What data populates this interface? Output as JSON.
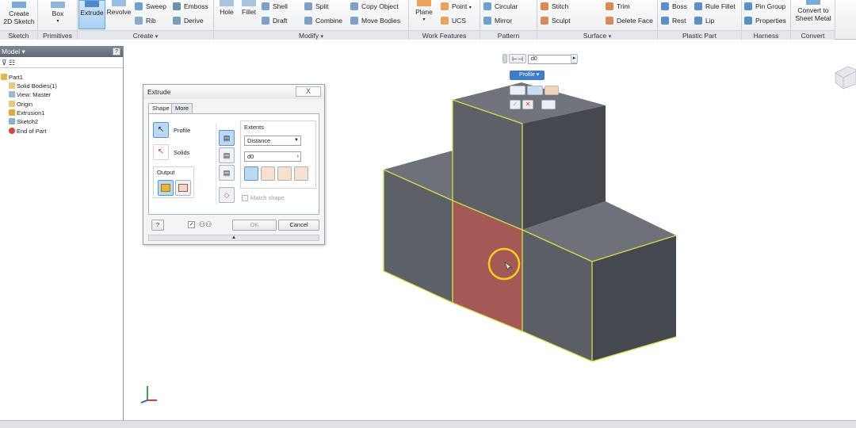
{
  "ribbon": {
    "panels": [
      {
        "name": "sketch",
        "title": "Sketch"
      },
      {
        "name": "primitives",
        "title": "Primitives"
      },
      {
        "name": "create",
        "title": "Create"
      },
      {
        "name": "modify",
        "title": "Modify"
      },
      {
        "name": "work_features",
        "title": "Work Features"
      },
      {
        "name": "pattern",
        "title": "Pattern"
      },
      {
        "name": "surface",
        "title": "Surface"
      },
      {
        "name": "plastic_part",
        "title": "Plastic Part"
      },
      {
        "name": "harness",
        "title": "Harness"
      },
      {
        "name": "convert",
        "title": "Convert"
      }
    ],
    "create_2d_sketch": "Create\n2D Sketch",
    "box": "Box",
    "extrude": "Extrude",
    "revolve": "Revolve",
    "sweep": "Sweep",
    "rib": "Rib",
    "emboss": "Emboss",
    "derive": "Derive",
    "hole": "Hole",
    "fillet": "Fillet",
    "shell": "Shell",
    "draft": "Draft",
    "split": "Split",
    "combine": "Combine",
    "copy_object": "Copy Object",
    "move_bodies": "Move Bodies",
    "plane": "Plane",
    "point": "Point",
    "ucs": "UCS",
    "circular": "Circular",
    "mirror": "Mirror",
    "stitch": "Stitch",
    "sculpt": "Sculpt",
    "trim": "Trim",
    "delete_face": "Delete Face",
    "boss": "Boss",
    "rest": "Rest",
    "rule_fillet": "Rule Fillet",
    "lip": "Lip",
    "pin_group": "Pin Group",
    "properties": "Properties",
    "convert_to_sheet_metal": "Convert to\nSheet Metal"
  },
  "browser": {
    "title": "Model ▾",
    "help": "?",
    "tools": "⊽  ☷",
    "items": [
      "Part1",
      "Solid Bodies(1)",
      "View: Master",
      "Origin",
      "Extrusion1",
      "Sketch2",
      "End of Part"
    ]
  },
  "dialog": {
    "title": "Extrude",
    "close": "X",
    "tabs": [
      "Shape",
      "More"
    ],
    "profile": "Profile",
    "solids": "Solids",
    "output": "Output",
    "extents": "Extents",
    "extents_value": "Distance",
    "distance_value": "d0",
    "match_shape": "Match shape",
    "ok": "OK",
    "cancel": "Cancel",
    "help": "?"
  },
  "minitoolbar": {
    "distance_value": "d0",
    "profile": "Profile"
  },
  "colors": {
    "accent": "#3d7cc9",
    "selection": "#d4e04a",
    "face_highlight": "#a35a56"
  }
}
